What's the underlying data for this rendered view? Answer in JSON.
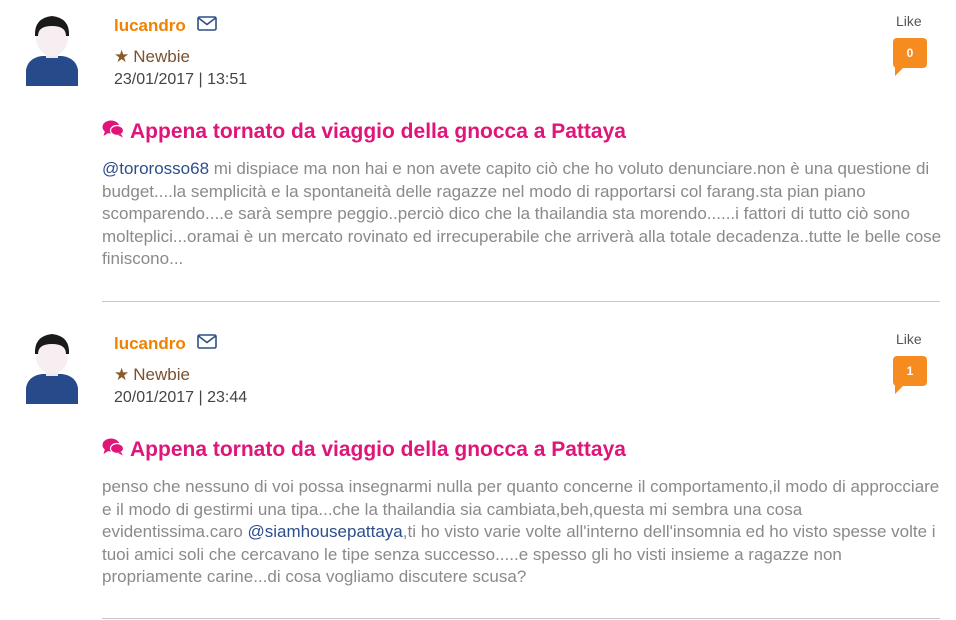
{
  "posts": [
    {
      "username": "lucandro",
      "rank": "Newbie",
      "date": "23/01/2017 | 13:51",
      "like_label": "Like",
      "like_count": "0",
      "title": "Appena tornato da viaggio della gnocca a Pattaya",
      "body_parts": [
        {
          "type": "mention",
          "text": "@tororosso68"
        },
        {
          "type": "text",
          "text": " mi dispiace ma non hai e non avete capito ciò che ho voluto denunciare.non è una questione di budget....la semplicità e la spontaneità delle ragazze nel modo di rapportarsi col farang.sta pian piano scomparendo....e sarà sempre peggio..perciò dico che la thailandia sta morendo......i fattori di tutto ciò sono molteplici...oramai è un mercato rovinato ed irrecuperabile che arriverà alla totale decadenza..tutte le belle cose finiscono..."
        }
      ]
    },
    {
      "username": "lucandro",
      "rank": "Newbie",
      "date": "20/01/2017 | 23:44",
      "like_label": "Like",
      "like_count": "1",
      "title": "Appena tornato da viaggio della gnocca a Pattaya",
      "body_parts": [
        {
          "type": "text",
          "text": "penso che nessuno di voi possa insegnarmi nulla per quanto concerne il comportamento,il modo di approcciare e il modo di gestirmi una tipa...che la thailandia sia cambiata,beh,questa mi sembra una cosa evidentissima.caro "
        },
        {
          "type": "mention",
          "text": "@siamhousepattaya"
        },
        {
          "type": "text",
          "text": ",ti ho visto varie volte all'interno dell'insomnia ed ho visto spesse volte i tuoi amici soli che cercavano le tipe senza successo.....e spesso gli ho visti insieme a ragazze non propriamente carine...di cosa vogliamo discutere scusa?"
        }
      ]
    }
  ],
  "colors": {
    "username": "#f08200",
    "rank": "#7a5230",
    "title": "#e0157a",
    "body": "#8a8a8a",
    "mention": "#2c4f8a",
    "like_badge": "#f68b1f",
    "avatar_shirt": "#274a8a",
    "avatar_hair": "#1a1a1a"
  },
  "icons": {
    "mail": "envelope-icon",
    "rank": "star-icon",
    "title": "comments-icon",
    "avatar": "user-avatar"
  }
}
